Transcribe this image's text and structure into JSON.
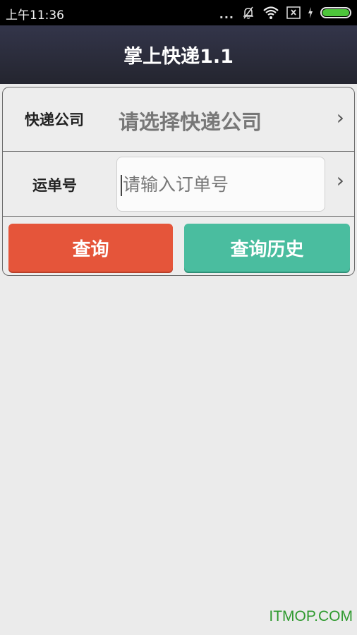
{
  "status_bar": {
    "time": "上午11:36",
    "icons": [
      "more-dots-icon",
      "notifications-muted-icon",
      "wifi-icon",
      "sim-none-icon",
      "charging-icon",
      "battery-icon"
    ],
    "more_dots": "...",
    "battery_color": "#4dc53b"
  },
  "header": {
    "title": "掌上快递1.1"
  },
  "form": {
    "company_label": "快递公司",
    "company_placeholder": "请选择快递公司",
    "order_label": "运单号",
    "order_placeholder": "请输入订单号",
    "order_value": "",
    "chevron": "›"
  },
  "buttons": {
    "query_label": "查询",
    "history_label": "查询历史",
    "query_color": "#e5553a",
    "history_color": "#4abd9f"
  },
  "watermark": "ITMOP.COM"
}
